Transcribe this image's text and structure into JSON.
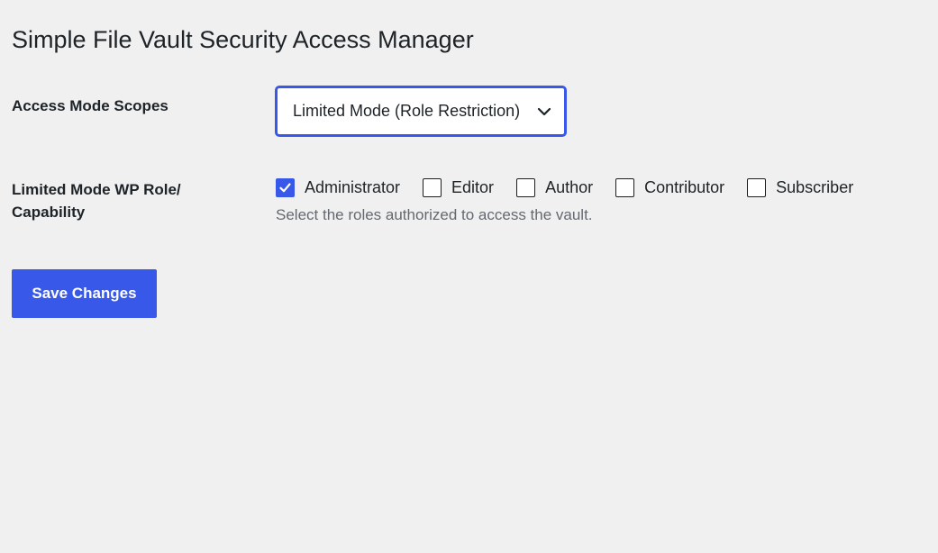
{
  "page": {
    "title": "Simple File Vault Security Access Manager"
  },
  "access_mode": {
    "label": "Access Mode Scopes",
    "selected": "Limited Mode (Role Restriction)"
  },
  "roles": {
    "label": "Limited Mode WP Role/ Capability",
    "items": [
      {
        "label": "Administrator",
        "checked": true
      },
      {
        "label": "Editor",
        "checked": false
      },
      {
        "label": "Author",
        "checked": false
      },
      {
        "label": "Contributor",
        "checked": false
      },
      {
        "label": "Subscriber",
        "checked": false
      }
    ],
    "help": "Select the roles authorized to access the vault."
  },
  "actions": {
    "save_label": "Save Changes"
  },
  "colors": {
    "accent": "#3858e9",
    "background": "#f0f0f1",
    "text": "#1d2327",
    "muted": "#646970"
  },
  "icons": {
    "select_chevron": "chevron-down-icon",
    "checkbox_check": "checkmark-icon"
  }
}
